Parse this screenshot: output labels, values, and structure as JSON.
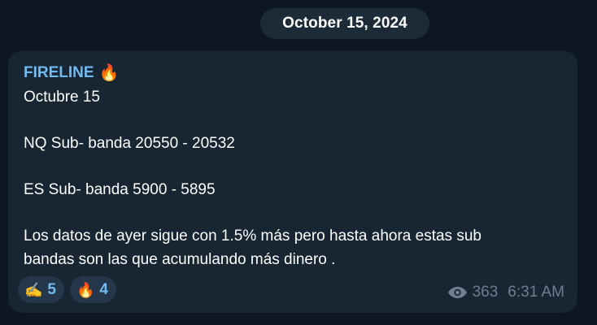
{
  "date_separator": "October 15, 2024",
  "message": {
    "sender": "FIRELINE",
    "sender_emoji": "🔥",
    "lines": [
      "Octubre 15",
      "",
      "NQ Sub- banda 20550 - 20532",
      "",
      "ES Sub- banda 5900 - 5895",
      "",
      "Los datos de ayer sigue con 1.5% más pero hasta ahora estas sub",
      "bandas son las que acumulando más dinero ."
    ],
    "reactions": [
      {
        "emoji": "✍️",
        "icon": "writing-hand-icon",
        "count": "5"
      },
      {
        "emoji": "🔥",
        "icon": "fire-icon",
        "count": "4"
      }
    ],
    "views": "363",
    "time": "6:31 AM"
  },
  "colors": {
    "background": "#0e1621",
    "bubble": "#182533",
    "accent": "#71baf2",
    "meta": "#6d7f91",
    "date_pill": "#1d2a38"
  }
}
